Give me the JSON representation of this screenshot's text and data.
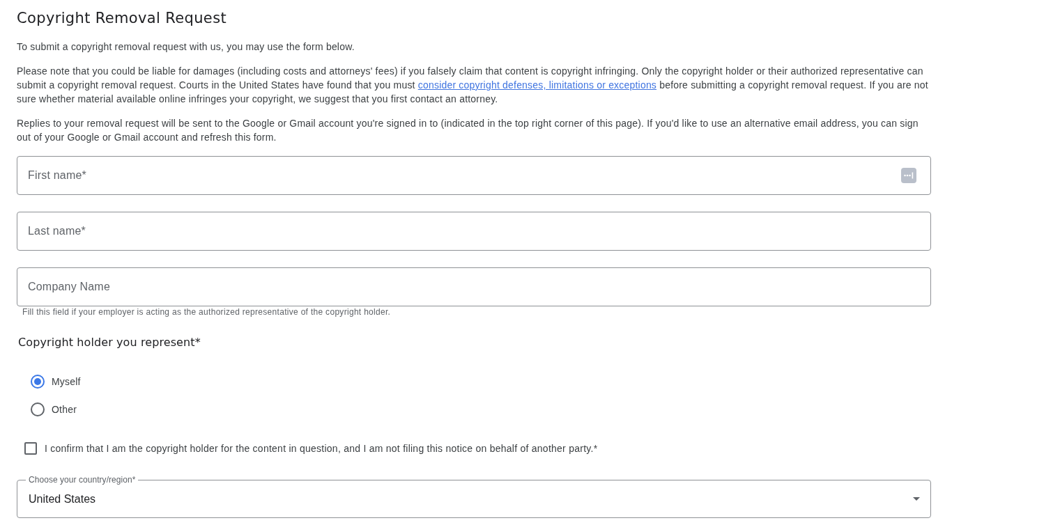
{
  "title": "Copyright Removal Request",
  "paragraphs": [
    {
      "text": "To submit a copyright removal request with us, you may use the form below."
    },
    {
      "text": "Please note that you could be liable for damages (including costs and attorneys' fees) if you falsely claim that content is copyright infringing. Only the copyright holder or their authorized representative can submit a copyright removal request. Courts in the United States have found that you must",
      "link": "consider copyright defenses, limitations or exceptions",
      "after": "before submitting a copyright removal request. If you are not sure whether material available online infringes your copyright, we suggest that you first contact an attorney."
    },
    {
      "text": "Replies to your removal request will be sent to the Google or Gmail account you're signed in to (indicated in the top right corner of this page). If you'd like to use an alternative email address, you can sign out of your Google or Gmail account and refresh this form."
    }
  ],
  "fields": [
    {
      "placeholder": "First name*",
      "autofill_icon": true
    },
    {
      "placeholder": "Last name*",
      "autofill_icon": false
    },
    {
      "placeholder": "Company Name",
      "autofill_icon": false,
      "helper": "Fill this field if your employer is acting as the authorized representative of the copyright holder."
    }
  ],
  "holder": {
    "heading": "Copyright holder you represent*",
    "options": [
      {
        "label": "Myself",
        "selected": true
      },
      {
        "label": "Other",
        "selected": false
      }
    ]
  },
  "confirm": {
    "label": "I confirm that I am the copyright holder for the content in question, and I am not filing this notice on behalf of another party.*",
    "checked": false
  },
  "country": {
    "label": "Choose your country/region*",
    "value": "United States"
  }
}
